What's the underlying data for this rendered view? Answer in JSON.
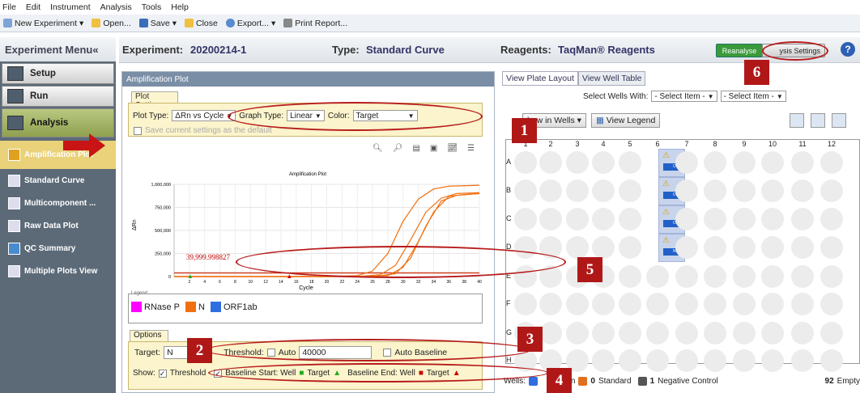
{
  "menubar": [
    "File",
    "Edit",
    "Instrument",
    "Analysis",
    "Tools",
    "Help"
  ],
  "toolbar": {
    "new": "New Experiment",
    "open": "Open...",
    "save": "Save",
    "close": "Close",
    "export": "Export...",
    "print": "Print Report..."
  },
  "left_menu": {
    "title": "Experiment Menu«",
    "nav": [
      {
        "label": "Setup"
      },
      {
        "label": "Run"
      },
      {
        "label": "Analysis"
      }
    ],
    "sub": [
      {
        "label": "Amplification Plot"
      },
      {
        "label": "Standard Curve"
      },
      {
        "label": "Multicomponent ..."
      },
      {
        "label": "Raw Data Plot"
      },
      {
        "label": "QC Summary"
      },
      {
        "label": "Multiple Plots View"
      }
    ]
  },
  "header": {
    "experiment_label": "Experiment:",
    "experiment_value": "20200214-1",
    "type_label": "Type:",
    "type_value": "Standard Curve",
    "reagents_label": "Reagents:",
    "reagents_value": "TaqMan® Reagents",
    "reanalyze": "Reanalyse",
    "analysis_settings": "ysis Settings",
    "help": "?"
  },
  "amp_panel": {
    "title": "Amplification Plot",
    "plot_settings_tab": "Plot Settings",
    "plot_type_label": "Plot Type:",
    "plot_type_value": "ΔRn vs Cycle",
    "graph_type_label": "Graph Type:",
    "graph_type_value": "Linear",
    "color_label": "Color:",
    "color_value": "Target",
    "save_default": "Save current settings as the default",
    "chart_title": "Amplification Plot",
    "y_label": "ΔRn",
    "x_label": "Cycle",
    "threshold_label": "39,999.998827",
    "legend_title": "Legend",
    "legend": [
      {
        "name": "RNase P",
        "color": "#ff00ff"
      },
      {
        "name": "N",
        "color": "#f07010"
      },
      {
        "name": "ORF1ab",
        "color": "#2f6ee0"
      }
    ],
    "options_tab": "Options",
    "target_label": "Target:",
    "target_value": "N",
    "threshold_text": "Threshold:",
    "auto": "Auto",
    "threshold_value": "40000",
    "auto_baseline": "Auto Baseline",
    "show_label": "Show:",
    "show_threshold": "Threshold",
    "baseline_start": "Baseline Start: Well",
    "target_a": "Target",
    "baseline_end": "Baseline End: Well",
    "target_b": "Target"
  },
  "chart_data": {
    "type": "line",
    "title": "Amplification Plot",
    "xlabel": "Cycle",
    "ylabel": "ΔRn",
    "xlim": [
      0,
      40
    ],
    "ylim": [
      0,
      1000000
    ],
    "x_ticks": [
      2,
      4,
      6,
      8,
      10,
      12,
      14,
      16,
      18,
      20,
      22,
      24,
      26,
      28,
      30,
      32,
      34,
      36,
      38,
      40
    ],
    "y_ticks": [
      0,
      250000,
      500000,
      750000,
      1000000
    ],
    "y_tick_labels": [
      "0",
      "250,000",
      "500,000",
      "750,000",
      "1,000,000"
    ],
    "threshold": 40000,
    "series": [
      {
        "color": "#f07010",
        "x": [
          0,
          20,
          24,
          26,
          28,
          30,
          32,
          34,
          36,
          40
        ],
        "y": [
          0,
          0,
          10000,
          60000,
          250000,
          600000,
          840000,
          950000,
          980000,
          990000
        ]
      },
      {
        "color": "#f07010",
        "x": [
          0,
          24,
          27,
          29,
          31,
          33,
          35,
          37,
          40
        ],
        "y": [
          0,
          0,
          20000,
          120000,
          400000,
          700000,
          850000,
          900000,
          910000
        ]
      },
      {
        "color": "#f07010",
        "x": [
          0,
          26,
          29,
          31,
          33,
          35,
          37,
          40
        ],
        "y": [
          0,
          0,
          30000,
          200000,
          550000,
          820000,
          880000,
          900000
        ]
      },
      {
        "color": "#f07010",
        "x": [
          0,
          25,
          28,
          30,
          32,
          34,
          36,
          38,
          40
        ],
        "y": [
          0,
          0,
          10000,
          100000,
          380000,
          700000,
          870000,
          890000,
          900000
        ]
      }
    ]
  },
  "right_panel": {
    "tab1": "View Plate Layout",
    "tab2": "View Well Table",
    "select_wells_label": "Select Wells With:",
    "select_item1": "- Select Item -",
    "select_item2": "- Select Item -",
    "show_in_wells": "how in Wells",
    "view_legend": "View Legend",
    "columns": [
      "1",
      "2",
      "3",
      "4",
      "5",
      "6",
      "7",
      "8",
      "9",
      "10",
      "11",
      "12"
    ],
    "rows": [
      "A",
      "B",
      "C",
      "D",
      "E",
      "F",
      "G",
      "H"
    ],
    "well_tags": [
      "ORF1",
      "ORF1",
      "OR",
      "N"
    ],
    "status": {
      "wells": "Wells:",
      "unknown": "own",
      "standard_count": "0",
      "standard": "Standard",
      "neg_count": "1",
      "neg": "Negative Control",
      "empty_count": "92",
      "empty": "Empty"
    }
  },
  "annotations": [
    "1",
    "2",
    "3",
    "4",
    "5",
    "6"
  ]
}
